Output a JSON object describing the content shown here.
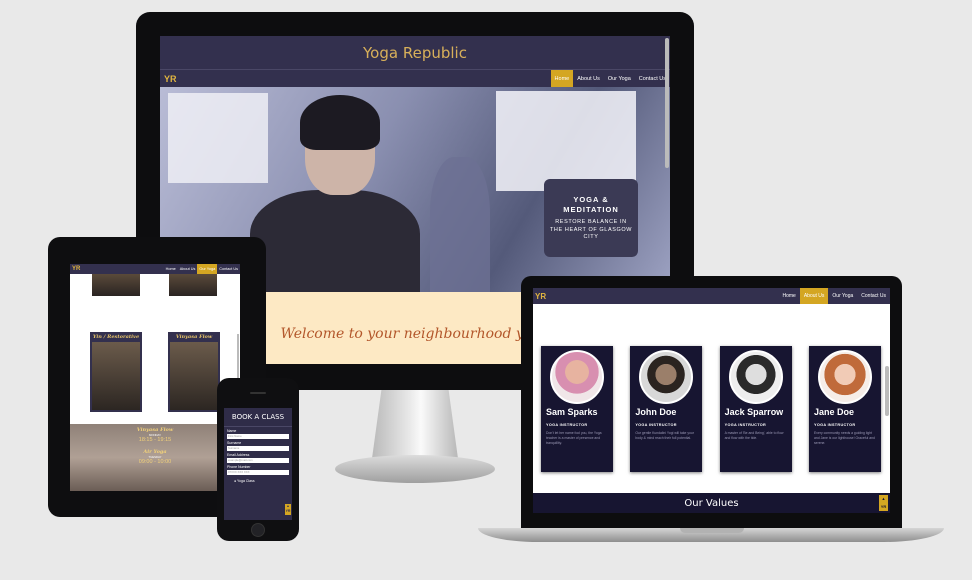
{
  "desktop": {
    "site_title": "Yoga Republic",
    "logo": "YR",
    "nav": [
      "Home",
      "About Us",
      "Our Yoga",
      "Contact Us"
    ],
    "hero_card": {
      "title": "YOGA & MEDITATION",
      "subtitle": "RESTORE BALANCE IN THE HEART OF GLASGOW CITY"
    },
    "welcome": "Welcome to your neighbourhood yoga"
  },
  "tablet": {
    "logo": "YR",
    "nav": [
      "Home",
      "About Us",
      "Our Yoga",
      "Contact Us"
    ],
    "classes": [
      "Yin / Restorative",
      "Vinyasa Flow"
    ],
    "schedule": [
      {
        "title": "Vinyasa Flow",
        "day": "MONDAY",
        "time": "18:15 - 19:15"
      },
      {
        "title": "Air Yoga",
        "day": "TUESDAY",
        "time": "09:00 - 10:00"
      }
    ]
  },
  "phone": {
    "form_title": "BOOK A CLASS",
    "fields": [
      {
        "label": "Name",
        "placeholder": "First Name"
      },
      {
        "label": "Surname",
        "placeholder": "Surname"
      },
      {
        "label": "Email Address",
        "placeholder": "example@mail.com"
      },
      {
        "label": "Phone Number",
        "placeholder": "07XXX XXX XXX"
      }
    ],
    "checkbox": "Yoga Class",
    "top_button": "YR"
  },
  "laptop": {
    "logo": "YR",
    "nav": [
      "Home",
      "About Us",
      "Our Yoga",
      "Contact Us"
    ],
    "team": [
      {
        "name": "Sam Sparks",
        "role": "YOGA INSTRUCTOR",
        "bio": "Don't let her name fool you, the Yoga teacher is a master of presence and tranquillity."
      },
      {
        "name": "John Doe",
        "role": "YOGA INSTRUCTOR",
        "bio": "Our gentle Kundalini Yogi will take your body & mind reach their full potential."
      },
      {
        "name": "Jack Sparrow",
        "role": "YOGA INSTRUCTOR",
        "bio": "A master of 'Be and Being', able to flow and flow with the tide."
      },
      {
        "name": "Jane Doe",
        "role": "YOGA INSTRUCTOR",
        "bio": "Every community needs a guiding light and Jane is our lighthouse! Graceful and serene."
      }
    ],
    "values_title": "Our Values",
    "top_button": "YR"
  },
  "colors": {
    "nav_bg": "#33304e",
    "accent": "#d4a622",
    "card_bg": "#171531",
    "welcome_bg": "#fde9c4",
    "welcome_text": "#b3572b"
  }
}
